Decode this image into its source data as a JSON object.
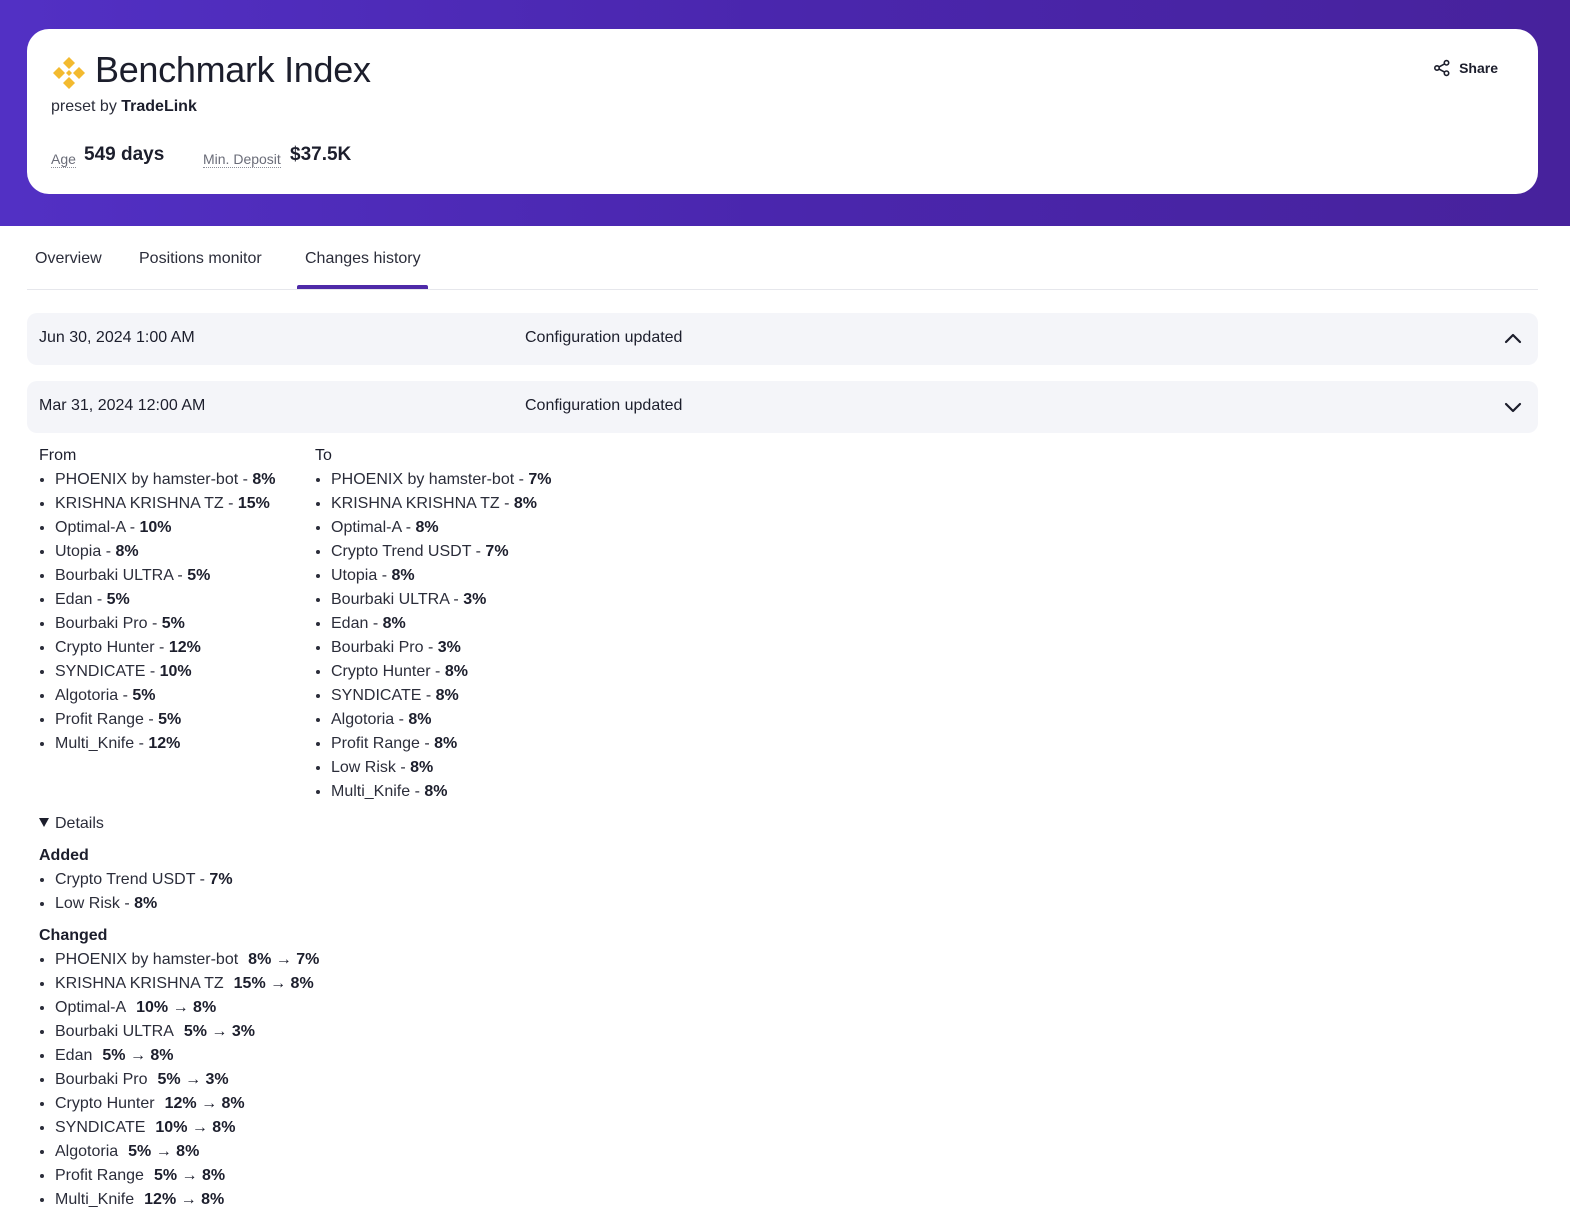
{
  "header": {
    "title": "Benchmark Index",
    "preset_prefix": "preset by",
    "preset_author": "TradeLink",
    "age_label": "Age",
    "age_value": "549 days",
    "deposit_label": "Min. Deposit",
    "deposit_value": "$37.5K",
    "share_label": "Share",
    "logo_icon": "binance-diamond-icon",
    "accent_color": "#F3BA2F",
    "hero_color": "#4E2AB5"
  },
  "tabs": [
    {
      "label": "Overview",
      "active": false
    },
    {
      "label": "Positions monitor",
      "active": false
    },
    {
      "label": "Changes history",
      "active": true
    }
  ],
  "history": [
    {
      "date": "Jun 30, 2024 1:00 AM",
      "description": "Configuration updated",
      "icon": "chevron-up-icon"
    },
    {
      "date": "Mar 31, 2024 12:00 AM",
      "description": "Configuration updated",
      "icon": "chevron-down-icon"
    }
  ],
  "from": {
    "title": "From",
    "items": [
      {
        "name": "PHOENIX by hamster-bot",
        "sep": " - ",
        "pct": "8%"
      },
      {
        "name": "KRISHNA KRISHNA TZ",
        "sep": " - ",
        "pct": "15%"
      },
      {
        "name": "Optimal-A",
        "sep": " - ",
        "pct": "10%"
      },
      {
        "name": "Utopia",
        "sep": " - ",
        "pct": "8%"
      },
      {
        "name": "Bourbaki ULTRA",
        "sep": " - ",
        "pct": "5%"
      },
      {
        "name": "Edan",
        "sep": " - ",
        "pct": "5%"
      },
      {
        "name": "Bourbaki Pro",
        "sep": " - ",
        "pct": "5%"
      },
      {
        "name": "Crypto Hunter",
        "sep": " - ",
        "pct": "12%"
      },
      {
        "name": "SYNDICATE",
        "sep": " - ",
        "pct": "10%"
      },
      {
        "name": "Algotoria",
        "sep": " - ",
        "pct": "5%"
      },
      {
        "name": "Profit Range",
        "sep": " - ",
        "pct": "5%"
      },
      {
        "name": "Multi_Knife",
        "sep": " - ",
        "pct": "12%"
      }
    ]
  },
  "to": {
    "title": "To",
    "items": [
      {
        "name": "PHOENIX by hamster-bot",
        "sep": " - ",
        "pct": "7%"
      },
      {
        "name": "KRISHNA KRISHNA TZ",
        "sep": " - ",
        "pct": "8%"
      },
      {
        "name": "Optimal-A",
        "sep": " - ",
        "pct": "8%"
      },
      {
        "name": "Crypto Trend USDT",
        "sep": " - ",
        "pct": "7%"
      },
      {
        "name": "Utopia",
        "sep": " - ",
        "pct": "8%"
      },
      {
        "name": "Bourbaki ULTRA",
        "sep": " - ",
        "pct": "3%"
      },
      {
        "name": "Edan",
        "sep": " - ",
        "pct": "8%"
      },
      {
        "name": "Bourbaki Pro",
        "sep": " - ",
        "pct": "3%"
      },
      {
        "name": "Crypto Hunter",
        "sep": " - ",
        "pct": "8%"
      },
      {
        "name": "SYNDICATE",
        "sep": " - ",
        "pct": "8%"
      },
      {
        "name": "Algotoria",
        "sep": " - ",
        "pct": "8%"
      },
      {
        "name": "Profit Range",
        "sep": " - ",
        "pct": "8%"
      },
      {
        "name": "Low Risk",
        "sep": " - ",
        "pct": "8%"
      },
      {
        "name": "Multi_Knife",
        "sep": " - ",
        "pct": "8%"
      }
    ]
  },
  "details": {
    "toggle_label": "Details",
    "added_title": "Added",
    "added": [
      {
        "name": "Crypto Trend USDT",
        "sep": " - ",
        "pct": "7%"
      },
      {
        "name": "Low Risk",
        "sep": " - ",
        "pct": "8%"
      }
    ],
    "changed_title": "Changed",
    "changed": [
      {
        "name": "PHOENIX by hamster-bot",
        "change": "8% → 7%"
      },
      {
        "name": "KRISHNA KRISHNA TZ",
        "change": "15% → 8%"
      },
      {
        "name": "Optimal-A",
        "change": "10% → 8%"
      },
      {
        "name": "Bourbaki ULTRA",
        "change": "5% → 3%"
      },
      {
        "name": "Edan",
        "change": "5% → 8%"
      },
      {
        "name": "Bourbaki Pro",
        "change": "5% → 3%"
      },
      {
        "name": "Crypto Hunter",
        "change": "12% → 8%"
      },
      {
        "name": "SYNDICATE",
        "change": "10% → 8%"
      },
      {
        "name": "Algotoria",
        "change": "5% → 8%"
      },
      {
        "name": "Profit Range",
        "change": "5% → 8%"
      },
      {
        "name": "Multi_Knife",
        "change": "12% → 8%"
      }
    ]
  }
}
